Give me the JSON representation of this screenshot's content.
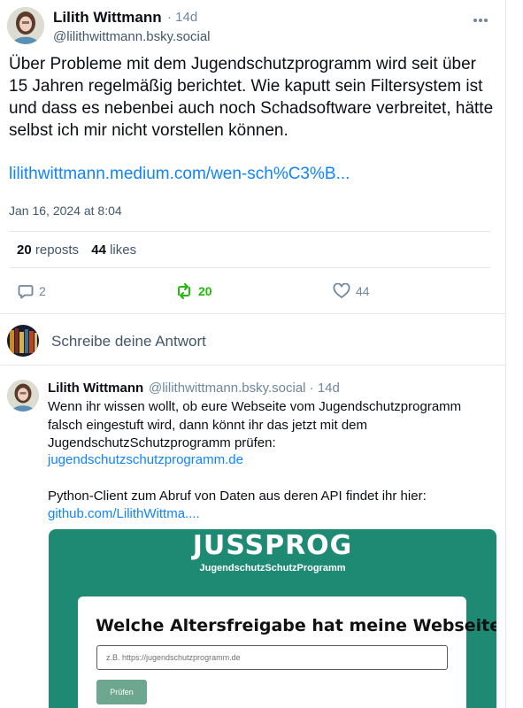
{
  "main_post": {
    "author_name": "Lilith Wittmann",
    "age": "· 14d",
    "handle": "@lilithwittmann.bsky.social",
    "text": "Über Probleme mit dem Jugendschutzprogramm wird seit über 15 Jahren regelmäßig berichtet. Wie kaputt sein Filtersystem ist und dass es nebenbei auch noch Schadsoftware verbreitet, hätte selbst ich mir nicht vorstellen können.",
    "link": "lilithwittmann.medium.com/wen-sch%C3%B...",
    "date": "Jan 16, 2024 at 8:04",
    "reposts_count": "20",
    "reposts_label": "reposts",
    "likes_count": "44",
    "likes_label": "likes",
    "reply_count": "2",
    "repost_action_count": "20",
    "like_action_count": "44"
  },
  "composer": {
    "placeholder": "Schreibe deine Antwort"
  },
  "reply_post": {
    "author_name": "Lilith Wittmann",
    "handle_age": "@lilithwittmann.bsky.social · 14d",
    "text": "Wenn ihr wissen wollt, ob eure Webseite vom Jugendschutzprogramm falsch eingestuft wird, dann könnt ihr das jetzt mit dem JugendschutzSchutzprogramm prüfen:",
    "link1": "jugendschutzschutzprogramm.de",
    "text2": "Python-Client zum Abruf von Daten aus deren API findet ihr hier:",
    "link2": "github.com/LilithWittma....",
    "card": {
      "title": "JUSSPROG",
      "subtitle": "JugendschutzSchutzProgramm",
      "question": "Welche Altersfreigabe hat meine Webseite?",
      "input_placeholder": "z.B. https://jugendschutzprogramm.de",
      "button": "Prüfen"
    }
  },
  "colors": {
    "link": "#1083fe",
    "repost_active": "#20bc07",
    "card_bg": "#1e8a74",
    "button_bg": "#6da78f"
  },
  "icons": [
    "more-icon",
    "reply-icon",
    "repost-icon",
    "heart-icon"
  ]
}
